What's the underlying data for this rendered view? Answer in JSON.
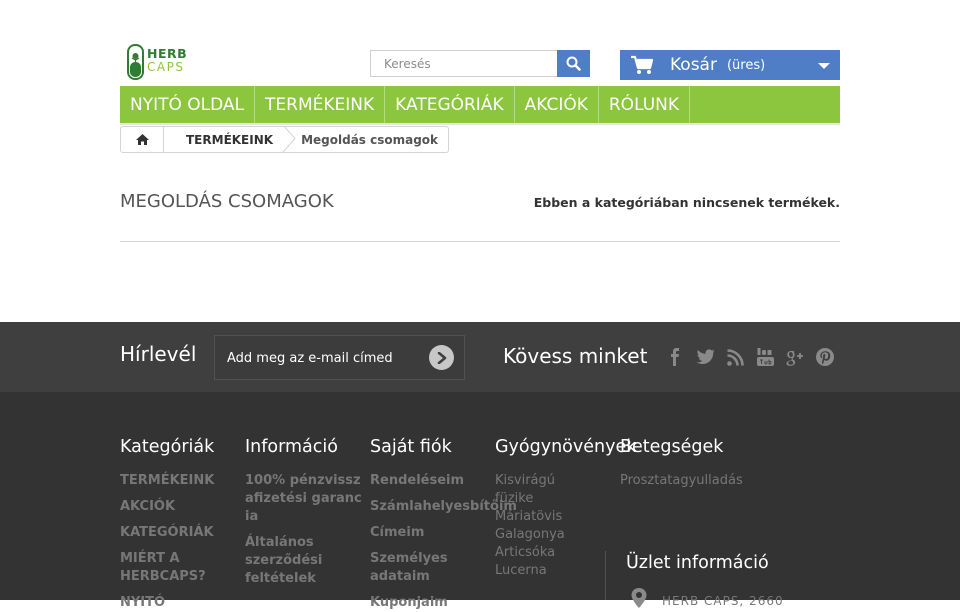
{
  "header": {
    "logo": {
      "line1": "HERB",
      "line2": "CAPS"
    },
    "search": {
      "placeholder": "Keresés"
    },
    "cart": {
      "label": "Kosár",
      "status": "(üres)"
    }
  },
  "menu": {
    "items": [
      "NYITÓ OLDAL",
      "TERMÉKEINK",
      "KATEGÓRIÁK",
      "AKCIÓK",
      "RÓLUNK"
    ]
  },
  "breadcrumb": {
    "items": [
      "TERMÉKEINK",
      "Megoldás csomagok"
    ]
  },
  "content": {
    "title": "MEGOLDÁS CSOMAGOK",
    "empty_message": "Ebben a kategóriában nincsenek termékek."
  },
  "newsletter": {
    "title": "Hírlevél",
    "placeholder": "Add meg az e-mail címed",
    "follow_title": "Kövess minket",
    "social_icons": [
      "facebook-icon",
      "twitter-icon",
      "rss-icon",
      "youtube-icon",
      "google-plus-icon",
      "pinterest-icon"
    ]
  },
  "footer": {
    "columns": [
      {
        "title": "Kategóriák",
        "links": [
          "TERMÉKEINK",
          "AKCIÓK",
          "KATEGÓRIÁK",
          "MIÉRT A HERBCAPS?",
          "NYITÓ"
        ]
      },
      {
        "title": "Információ",
        "links": [
          "100% pénzvisszafizetési garancia",
          "Általános szerződési feltételek"
        ]
      },
      {
        "title": "Saját fiók",
        "links": [
          "Rendeléseim",
          "Számlahelyesbítőim",
          "Címeim",
          "Személyes adataim",
          "Kuponjaim"
        ]
      },
      {
        "title": "Gyógynövények",
        "links": [
          "Kisvirágú füzike",
          "Máriatövis",
          "Galagonya",
          "Articsóka",
          "Lucerna"
        ]
      },
      {
        "title": "Betegségek",
        "links": [
          "Prosztatagyulladás"
        ]
      }
    ],
    "shop_info": {
      "title": "Üzlet információ",
      "address": "HERB CAPS, 2660"
    }
  },
  "colors": {
    "menu_green": "#8cc63e",
    "cart_blue": "#4f7ec7",
    "newsletter_bg": "#3f3f3f",
    "footer_bg": "#333333"
  }
}
